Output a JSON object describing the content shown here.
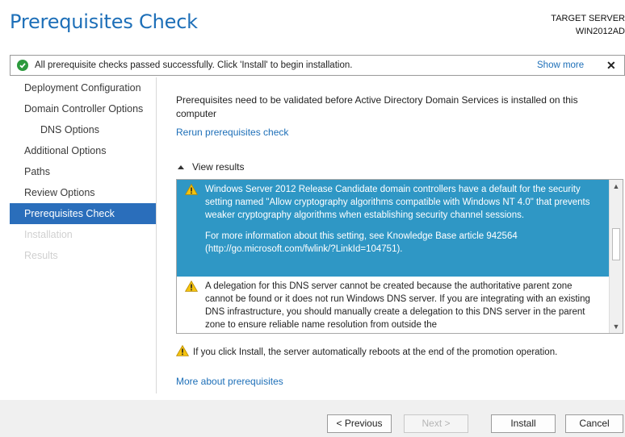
{
  "header": {
    "title": "Prerequisites Check",
    "target_label": "TARGET SERVER",
    "target_name": "WIN2012AD"
  },
  "banner": {
    "message": "All prerequisite checks passed successfully.  Click 'Install' to begin installation.",
    "show_more": "Show more",
    "close": "✕"
  },
  "sidebar": {
    "items": [
      {
        "label": "Deployment Configuration",
        "state": "normal"
      },
      {
        "label": "Domain Controller Options",
        "state": "normal"
      },
      {
        "label": "DNS Options",
        "state": "normal"
      },
      {
        "label": "Additional Options",
        "state": "normal"
      },
      {
        "label": "Paths",
        "state": "normal"
      },
      {
        "label": "Review Options",
        "state": "normal"
      },
      {
        "label": "Prerequisites Check",
        "state": "active"
      },
      {
        "label": "Installation",
        "state": "disabled"
      },
      {
        "label": "Results",
        "state": "disabled"
      }
    ]
  },
  "main": {
    "intro": "Prerequisites need to be validated before Active Directory Domain Services is installed on this computer",
    "rerun_link": "Rerun prerequisites check",
    "view_results": "View results",
    "results": [
      {
        "text": "Windows Server 2012 Release Candidate domain controllers have a default for the security setting named \"Allow cryptography algorithms compatible with Windows NT 4.0\" that prevents weaker cryptography algorithms when establishing security channel sessions.",
        "text2": "For more information about this setting, see Knowledge Base article 942564 (http://go.microsoft.com/fwlink/?LinkId=104751)."
      },
      {
        "text": "A delegation for this DNS server cannot be created because the authoritative parent zone cannot be found or it does not run Windows DNS server. If you are integrating with an existing DNS infrastructure, you should manually create a delegation to this DNS server in the parent zone to ensure reliable name resolution from outside the"
      }
    ],
    "reboot_warning": "If you click Install, the server automatically reboots at the end of the promotion operation.",
    "more_link": "More about prerequisites"
  },
  "footer": {
    "previous": "< Previous",
    "next": "Next >",
    "install": "Install",
    "cancel": "Cancel"
  },
  "colors": {
    "accent": "#2a6ebb",
    "selected_row": "#2f97c5",
    "success": "#2c9a3d",
    "warning": "#f4c20d"
  }
}
